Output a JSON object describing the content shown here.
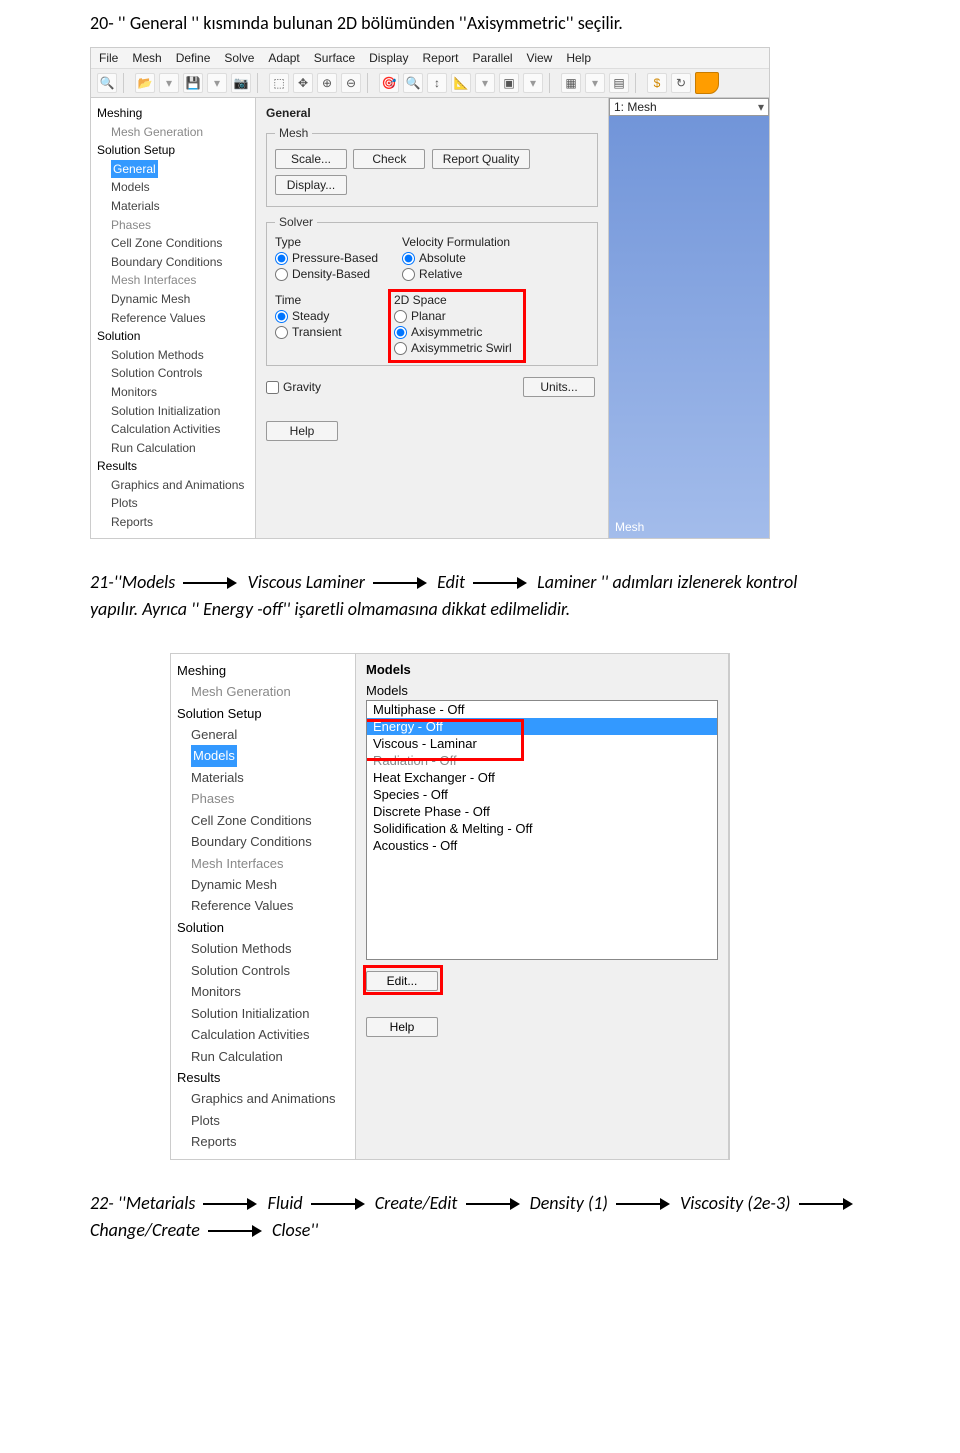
{
  "doc": {
    "p1": "20- '' General '' kısmında bulunan 2D bölümünden ''Axisymmetric'' seçilir.",
    "p2_a": "21-''Models",
    "p2_b": "Viscous Laminer",
    "p2_c": "Edit",
    "p2_d": "Laminer '' adımları izlenerek kontrol",
    "p2_e": "yapılır. Ayrıca '' Energy -off'' işaretli olmamasına dikkat edilmelidir.",
    "p3_a": "22- ''Metarials",
    "p3_b": "Fluid",
    "p3_c": "Create/Edit",
    "p3_d": "Density (1)",
    "p3_e": "Viscosity (2e-3)",
    "p3_f": "Change/Create",
    "p3_g": "Close''"
  },
  "shot1": {
    "menu": [
      "File",
      "Mesh",
      "Define",
      "Solve",
      "Adapt",
      "Surface",
      "Display",
      "Report",
      "Parallel",
      "View",
      "Help"
    ],
    "tree": {
      "meshing": "Meshing",
      "mesh_gen": "Mesh Generation",
      "setup": "Solution Setup",
      "general": "General",
      "models": "Models",
      "materials": "Materials",
      "phases": "Phases",
      "czc": "Cell Zone Conditions",
      "bc": "Boundary Conditions",
      "mi": "Mesh Interfaces",
      "dm": "Dynamic Mesh",
      "rv": "Reference Values",
      "solution": "Solution",
      "sm": "Solution Methods",
      "sc": "Solution Controls",
      "mon": "Monitors",
      "si": "Solution Initialization",
      "ca": "Calculation Activities",
      "rc": "Run Calculation",
      "results": "Results",
      "ga": "Graphics and Animations",
      "plots": "Plots",
      "reports": "Reports"
    },
    "panel": {
      "title": "General",
      "mesh_legend": "Mesh",
      "scale_btn": "Scale...",
      "check_btn": "Check",
      "rq_btn": "Report Quality",
      "display_btn": "Display...",
      "solver_legend": "Solver",
      "type_label": "Type",
      "type_pb": "Pressure-Based",
      "type_db": "Density-Based",
      "vf_label": "Velocity Formulation",
      "vf_abs": "Absolute",
      "vf_rel": "Relative",
      "time_label": "Time",
      "time_steady": "Steady",
      "time_trans": "Transient",
      "sp_label": "2D Space",
      "sp_planar": "Planar",
      "sp_axi": "Axisymmetric",
      "sp_axis": "Axisymmetric Swirl",
      "gravity": "Gravity",
      "units_btn": "Units...",
      "help_btn": "Help"
    },
    "view": {
      "dd": "1: Mesh",
      "label": "Mesh"
    }
  },
  "shot2": {
    "tree": {
      "meshing": "Meshing",
      "mesh_gen": "Mesh Generation",
      "setup": "Solution Setup",
      "general": "General",
      "models": "Models",
      "materials": "Materials",
      "phases": "Phases",
      "czc": "Cell Zone Conditions",
      "bc": "Boundary Conditions",
      "mi": "Mesh Interfaces",
      "dm": "Dynamic Mesh",
      "rv": "Reference Values",
      "solution": "Solution",
      "sm": "Solution Methods",
      "sc": "Solution Controls",
      "mon": "Monitors",
      "si": "Solution Initialization",
      "ca": "Calculation Activities",
      "rc": "Run Calculation",
      "results": "Results",
      "ga": "Graphics and Animations",
      "plots": "Plots",
      "reports": "Reports"
    },
    "panel": {
      "title": "Models",
      "list_label": "Models",
      "items": [
        "Multiphase - Off",
        "Energy - Off",
        "Viscous - Laminar",
        "Radiation - Off",
        "Heat Exchanger - Off",
        "Species - Off",
        "Discrete Phase - Off",
        "Solidification & Melting - Off",
        "Acoustics - Off"
      ],
      "edit_btn": "Edit...",
      "help_btn": "Help"
    }
  }
}
